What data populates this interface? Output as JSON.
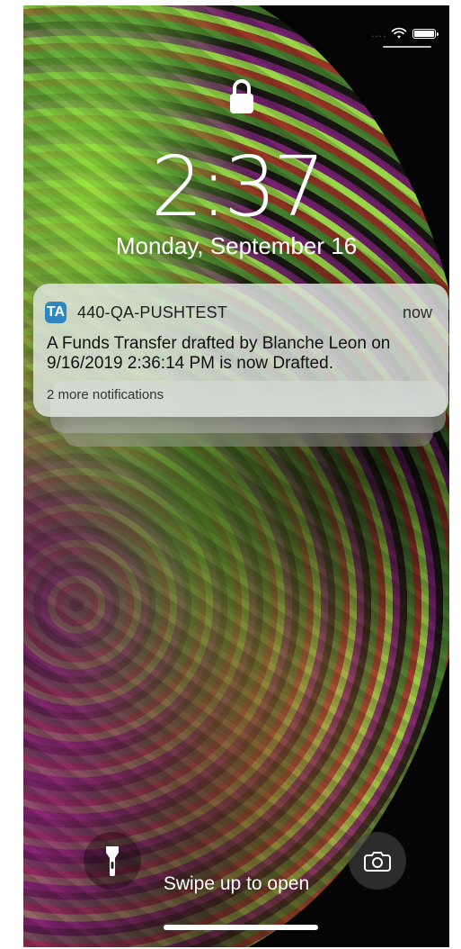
{
  "status_bar": {
    "signal_dots": "....",
    "wifi_icon": "wifi-icon",
    "battery_icon": "battery-icon"
  },
  "lock_screen": {
    "lock_icon": "lock-icon",
    "time": "2:37",
    "date": "Monday, September 16",
    "bottom_hint": "Swipe up to open"
  },
  "notification": {
    "app_icon_text": "TA",
    "app_name": "440-QA-PUSHTEST",
    "time": "now",
    "message": "A Funds Transfer drafted by Blanche Leon on 9/16/2019 2:36:14 PM is now Drafted.",
    "more": "2 more notifications"
  },
  "controls": {
    "flashlight_icon": "flashlight-icon",
    "camera_icon": "camera-icon"
  },
  "colors": {
    "notification_background": "#DFE5E0",
    "app_icon": "#2F87C2",
    "text_white": "#FFFFFF"
  }
}
